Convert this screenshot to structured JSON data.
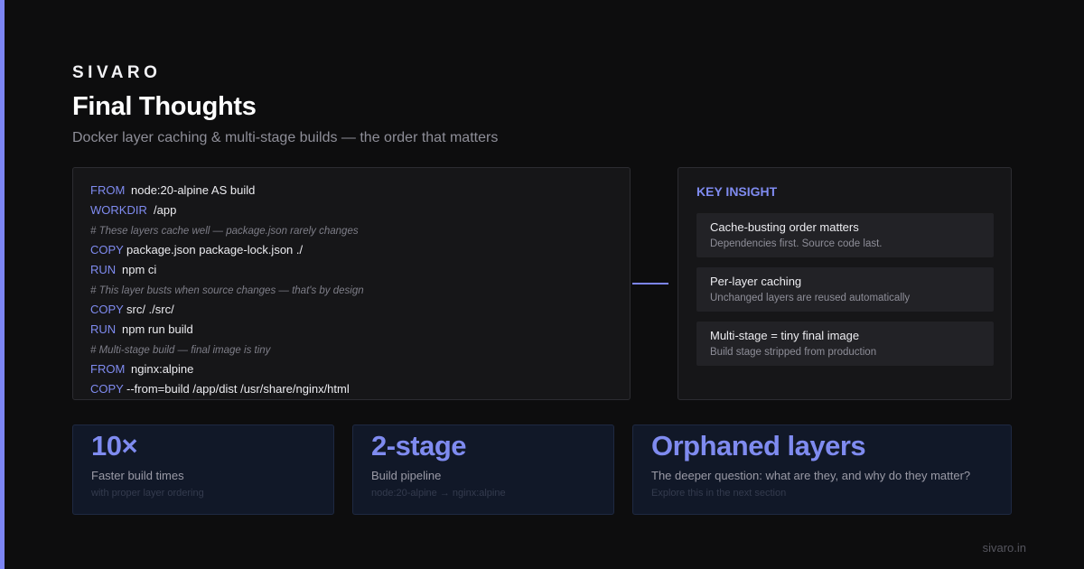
{
  "brand": "SIVARO",
  "title": "Final Thoughts",
  "subtitle": "Docker layer caching & multi-stage builds — the order that matters",
  "code": [
    {
      "kw": "FROM",
      "arg": "node:20-alpine AS build"
    },
    {
      "kw": "WORKDIR",
      "arg": "/app"
    },
    {
      "comment": "# These layers cache well — package.json rarely changes"
    },
    {
      "kw": "COPY",
      "arg": "package.json package-lock.json ./"
    },
    {
      "kw": "RUN",
      "arg": "npm ci"
    },
    {
      "comment": "# This layer busts when source changes — that's by design"
    },
    {
      "kw": "COPY",
      "arg": "src/ ./src/"
    },
    {
      "kw": "RUN",
      "arg": "npm run build"
    },
    {
      "comment": "# Multi-stage build — final image is tiny"
    },
    {
      "kw": "FROM",
      "arg": "nginx:alpine"
    },
    {
      "kw": "COPY",
      "arg": "--from=build /app/dist /usr/share/nginx/html"
    }
  ],
  "insight": {
    "header": "KEY INSIGHT",
    "items": [
      {
        "title": "Cache-busting order matters",
        "desc": "Dependencies first. Source code last."
      },
      {
        "title": "Per-layer caching",
        "desc": "Unchanged layers are reused automatically"
      },
      {
        "title": "Multi-stage = tiny final image",
        "desc": "Build stage stripped from production"
      }
    ]
  },
  "stats": [
    {
      "value": "10×",
      "label": "Faster build times",
      "sub": "with proper layer ordering"
    },
    {
      "value": "2-stage",
      "label": "Build pipeline",
      "sub": "node:20-alpine → nginx:alpine"
    },
    {
      "value": "Orphaned layers",
      "label": "The deeper question: what are they, and why do they matter?",
      "sub": "Explore this in the next section"
    }
  ],
  "footer": "sivaro.in",
  "colors": {
    "background": "#0d0d0e",
    "accent": "#7c85f4",
    "panel": "#161618",
    "stat_card": "#111828"
  }
}
